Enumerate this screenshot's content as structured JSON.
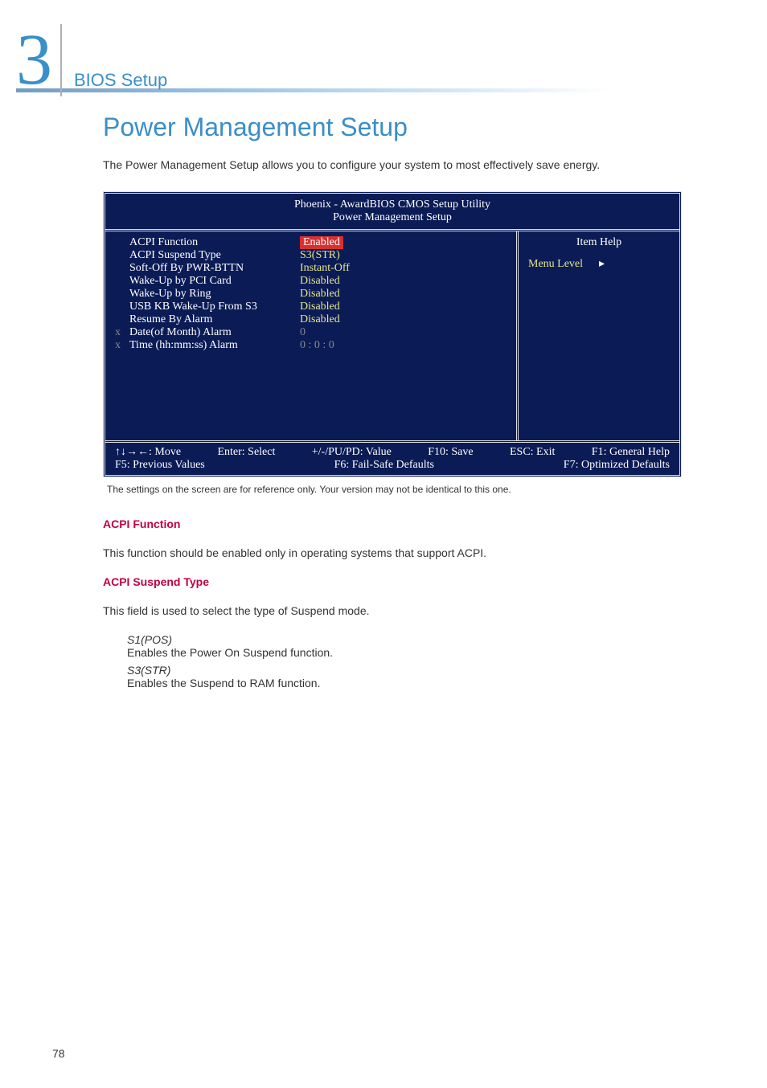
{
  "chapter_number": "3",
  "section_name": "BIOS Setup",
  "main_title": "Power Management Setup",
  "intro": "The Power Management Setup allows you to configure your system to most effectively save energy.",
  "bios": {
    "title_line1": "Phoenix - AwardBIOS CMOS Setup Utility",
    "title_line2": "Power Management Setup",
    "rows": [
      {
        "label": "ACPI Function",
        "value": "Enabled",
        "highlight": true
      },
      {
        "label": "ACPI Suspend Type",
        "value": "S3(STR)"
      },
      {
        "label": "Soft-Off By PWR-BTTN",
        "value": "Instant-Off"
      },
      {
        "label": "Wake-Up by PCI Card",
        "value": "Disabled"
      },
      {
        "label": "Wake-Up by Ring",
        "value": "Disabled"
      },
      {
        "label": "USB KB Wake-Up From S3",
        "value": "Disabled"
      },
      {
        "label": "Resume By Alarm",
        "value": "Disabled"
      }
    ],
    "x_rows": [
      {
        "label": "Date(of Month) Alarm",
        "value": "0"
      },
      {
        "label": "Time (hh:mm:ss) Alarm",
        "value": "0 : 0 : 0"
      }
    ],
    "item_help": "Item Help",
    "menu_level": "Menu Level",
    "footer": {
      "move": "↑↓→←: Move",
      "select": "Enter: Select",
      "value": "+/-/PU/PD: Value",
      "save": "F10: Save",
      "exit": "ESC: Exit",
      "help": "F1: General Help",
      "prev": "F5: Previous Values",
      "failsafe": "F6: Fail-Safe Defaults",
      "optimized": "F7: Optimized Defaults"
    }
  },
  "caption": "The settings on the screen are for reference only. Your version may not be identical to this one.",
  "h_acpi_func": "ACPI Function",
  "acpi_func_text": "This function should be enabled only in operating systems that support ACPI.",
  "h_acpi_suspend": "ACPI Suspend Type",
  "acpi_suspend_text": "This field is used to select the type of Suspend mode.",
  "s1_title": "S1(POS)",
  "s1_text": "Enables the Power On Suspend function.",
  "s3_title": "S3(STR)",
  "s3_text": "Enables the Suspend to RAM function.",
  "page_num": "78"
}
